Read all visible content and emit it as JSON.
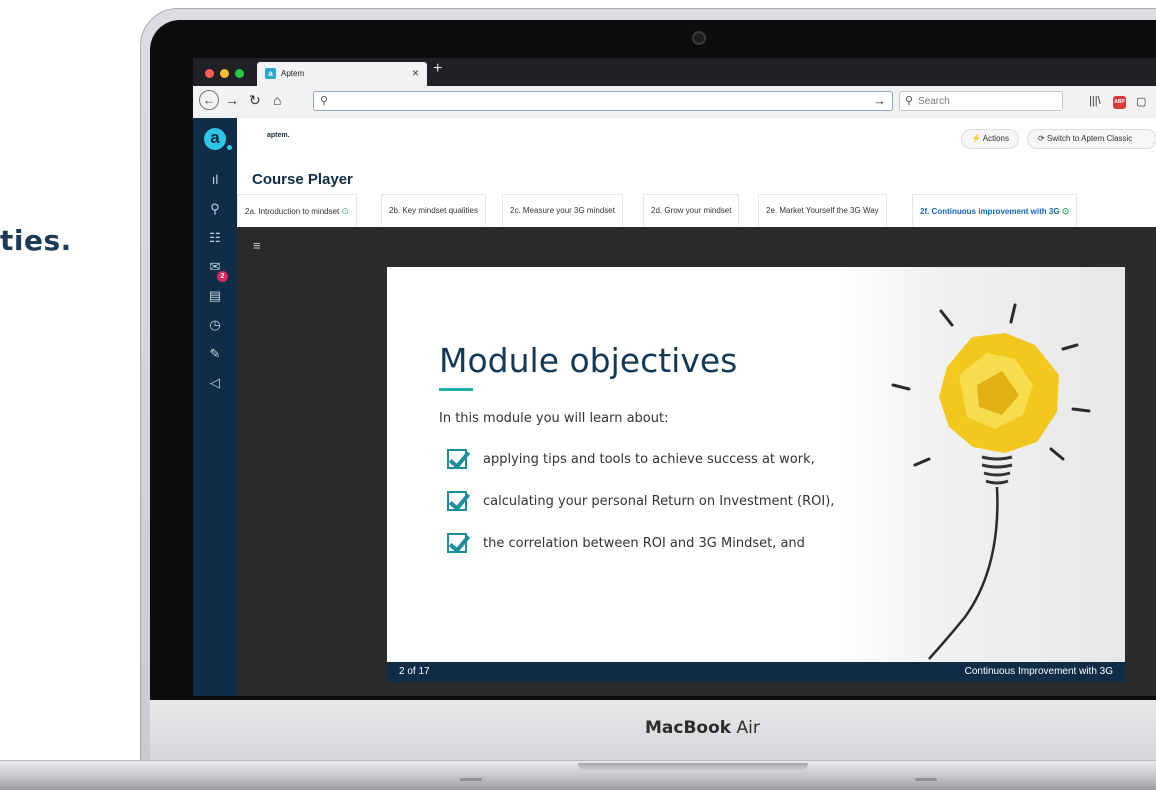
{
  "background": {
    "partial_heading": "ties."
  },
  "laptop": {
    "brand_bold": "MacBook",
    "brand_light": "Air"
  },
  "browser": {
    "tab_title": "Aptem",
    "tab_favicon": "a",
    "new_tab": "+",
    "close_tab": "×",
    "search_placeholder": "Search",
    "abp_label": "ABP",
    "icons": {
      "back": "←",
      "forward": "→",
      "reload": "↻",
      "home": "⌂",
      "url_search": "⚲",
      "go": "→",
      "library": "|||\\",
      "sidebar": "▢"
    }
  },
  "app": {
    "logo": "a",
    "org_logo": "aptem.",
    "actions_label": "⚡ Actions",
    "switch_label": "⟳ Switch to Aptem Classic",
    "page_title": "Course Player",
    "sidebar_badge": "2",
    "sidebar_icons": [
      "ıl",
      "⚲",
      "☷",
      "✉",
      "▤",
      "◷",
      "✎",
      "◁"
    ],
    "tabs": [
      {
        "label": "2a. Introduction to mindset",
        "done": "⊙"
      },
      {
        "label": "2b. Key mindset qualities",
        "done": ""
      },
      {
        "label": "2c. Measure your 3G mindset",
        "done": ""
      },
      {
        "label": "2d. Grow your mindset",
        "done": ""
      },
      {
        "label": "2e. Market Yourself the 3G Way",
        "done": ""
      },
      {
        "label": "2f. Continuous improvement with 3G",
        "done": "⊙"
      }
    ],
    "menu_icon": "≡"
  },
  "slide": {
    "title": "Module objectives",
    "intro": "In this module you will learn about:",
    "objectives": [
      "applying tips and tools to achieve success at work,",
      "calculating your personal Return on Investment (ROI),",
      "the correlation between ROI and 3G Mindset, and"
    ],
    "page_counter": "2 of 17",
    "footer_title": "Continuous Improvement with 3G"
  },
  "colors": {
    "navy": "#0f2d46",
    "teal": "#1fb5a6",
    "active_tab": "#1466c2",
    "bulb": "#f2c81e"
  }
}
